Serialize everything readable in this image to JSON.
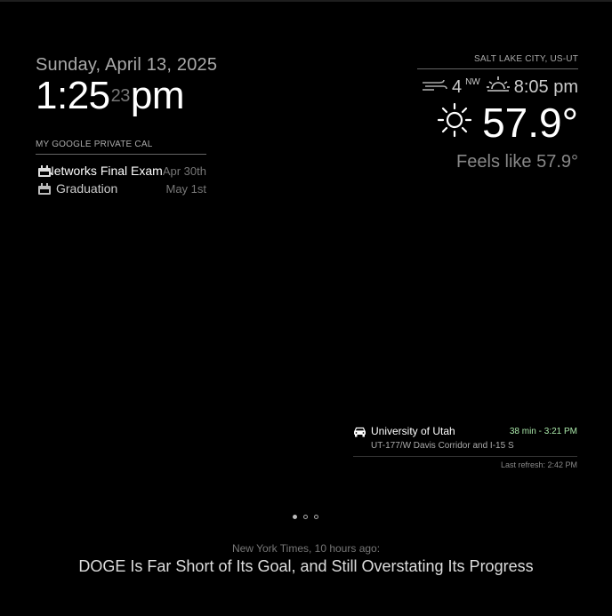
{
  "clock": {
    "date": "Sunday, April 13, 2025",
    "hours_minutes": "1:25",
    "seconds": "23",
    "period": "pm"
  },
  "calendar": {
    "header": "MY GOOGLE PRIVATE CAL",
    "events": [
      {
        "title": "Networks Final Exam",
        "date": "Apr 30th"
      },
      {
        "title": "Graduation",
        "date": "May 1st"
      }
    ]
  },
  "weather": {
    "location": "SALT LAKE CITY, US-UT",
    "wind_speed": "4",
    "wind_direction": "NW",
    "sunset_time": "8:05 pm",
    "temperature": "57.9°",
    "feels_like": "Feels like 57.9°",
    "icons": {
      "wind": "wind-icon",
      "sunset": "sunset-icon",
      "condition": "sunny-icon"
    }
  },
  "traffic": {
    "destination": "University of Utah",
    "eta": "38 min - 3:21 PM",
    "route": "UT-177/W Davis Corridor and I-15 S",
    "last_refresh": "Last refresh: 2:42 PM",
    "eta_color": "#a8e6a8"
  },
  "pager": {
    "count": 3,
    "active_index": 0
  },
  "news": {
    "source": "New York Times, 10 hours ago:",
    "headline": "DOGE Is Far Short of Its Goal, and Still Overstating Its Progress"
  }
}
